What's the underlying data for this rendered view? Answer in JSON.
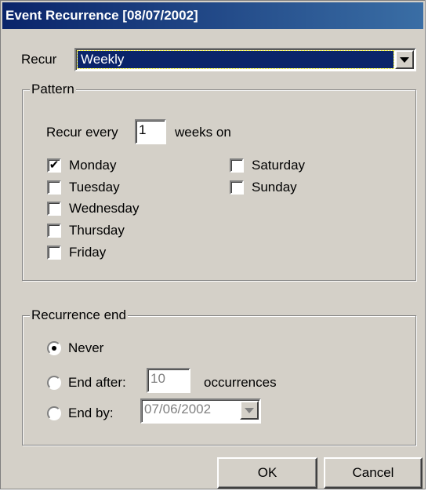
{
  "window": {
    "title": "Event Recurrence [08/07/2002]"
  },
  "recur": {
    "label": "Recur",
    "selected": "Weekly"
  },
  "pattern": {
    "group_title": "Pattern",
    "recur_every_label": "Recur every",
    "recur_every_value": "1",
    "weeks_on_label": "weeks on",
    "days": [
      {
        "label": "Monday",
        "checked": true
      },
      {
        "label": "Tuesday",
        "checked": false
      },
      {
        "label": "Wednesday",
        "checked": false
      },
      {
        "label": "Thursday",
        "checked": false
      },
      {
        "label": "Friday",
        "checked": false
      },
      {
        "label": "Saturday",
        "checked": false
      },
      {
        "label": "Sunday",
        "checked": false
      }
    ]
  },
  "recurrence_end": {
    "group_title": "Recurrence end",
    "never_label": "Never",
    "end_after_label": "End after:",
    "end_after_value": "10",
    "occurrences_label": "occurrences",
    "end_by_label": "End by:",
    "end_by_value": "07/06/2002",
    "selected": "never"
  },
  "buttons": {
    "ok": "OK",
    "cancel": "Cancel"
  },
  "colors": {
    "titlebar_start": "#0a246a",
    "titlebar_end": "#3a6ea5",
    "dialog_bg": "#d4d0c8"
  }
}
